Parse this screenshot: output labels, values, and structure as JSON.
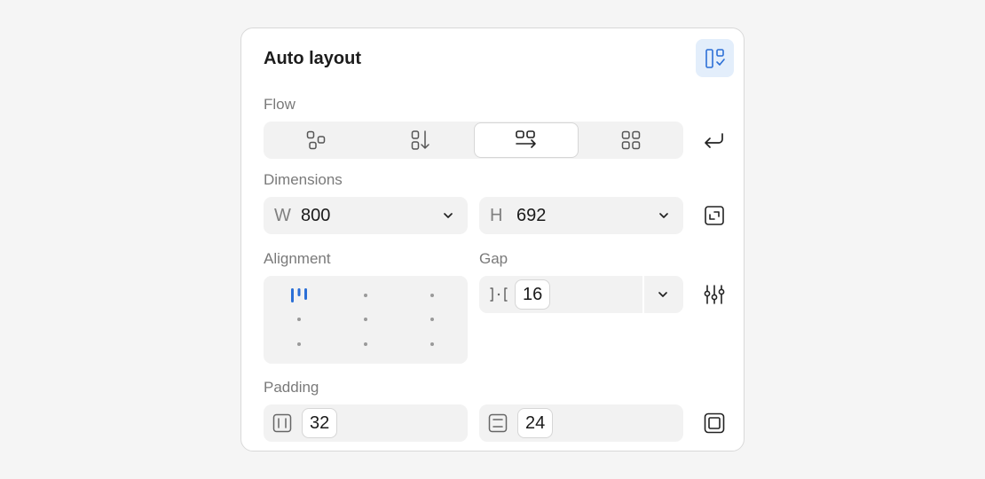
{
  "panel": {
    "title": "Auto layout"
  },
  "flow": {
    "label": "Flow",
    "options": [
      {
        "icon": "freeform-layout-icon",
        "active": false
      },
      {
        "icon": "vertical-flow-icon",
        "active": false
      },
      {
        "icon": "horizontal-flow-icon",
        "active": true
      },
      {
        "icon": "grid-flow-icon",
        "active": false
      }
    ],
    "wrap_icon": "wrap-arrow-icon"
  },
  "dimensions": {
    "label": "Dimensions",
    "width": {
      "prefix": "W",
      "value": "800"
    },
    "height": {
      "prefix": "H",
      "value": "692"
    },
    "side_icon": "resize-to-fit-icon"
  },
  "alignment": {
    "label": "Alignment",
    "selected": "top-left"
  },
  "gap": {
    "label": "Gap",
    "value": "16",
    "side_icon": "advanced-settings-icon"
  },
  "padding": {
    "label": "Padding",
    "horizontal": "32",
    "vertical": "24",
    "side_icon": "individual-padding-icon"
  },
  "colors": {
    "accent": "#2b6fd6",
    "accent_bg": "#e3eefb",
    "field_bg": "#f2f2f2",
    "label": "#7a7a7a"
  }
}
